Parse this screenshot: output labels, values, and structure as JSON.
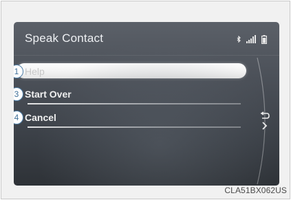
{
  "screen": {
    "title": "Speak Contact",
    "status_icons": [
      "bluetooth-icon",
      "signal-strength-icon",
      "battery-icon"
    ]
  },
  "menu": {
    "items": [
      {
        "number": "1",
        "label": "Help",
        "state": "selected"
      },
      {
        "number": "3",
        "label": "Start Over",
        "state": "normal"
      },
      {
        "number": "4",
        "label": "Cancel",
        "state": "normal"
      }
    ]
  },
  "controls": {
    "back_icon": "back-arrow-icon",
    "next_icon": "chevron-right-icon"
  },
  "figure": {
    "caption": "CLA51BX062US"
  },
  "colors": {
    "screen_bg": "#4b5058",
    "callout_border": "#4f7fa8",
    "selected_pill": "#f3f3f3"
  }
}
